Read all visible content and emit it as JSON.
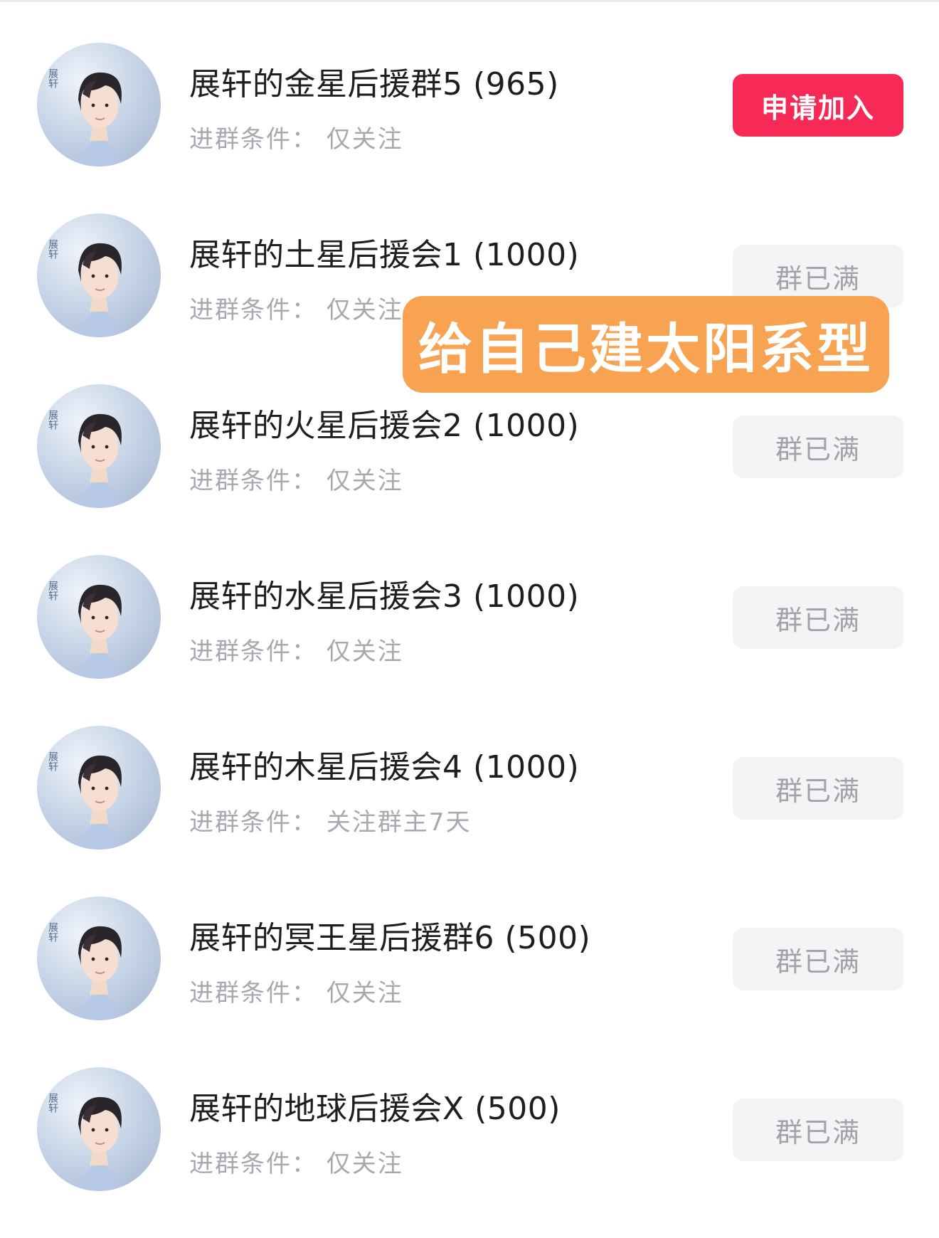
{
  "groups": [
    {
      "name": "展轩的金星后援群5 (965)",
      "condition": "进群条件： 仅关注",
      "button": "申请加入",
      "button_state": "join"
    },
    {
      "name": "展轩的土星后援会1 (1000)",
      "condition": "进群条件： 仅关注",
      "button": "群已满",
      "button_state": "full"
    },
    {
      "name": "展轩的火星后援会2 (1000)",
      "condition": "进群条件： 仅关注",
      "button": "群已满",
      "button_state": "full"
    },
    {
      "name": "展轩的水星后援会3 (1000)",
      "condition": "进群条件： 仅关注",
      "button": "群已满",
      "button_state": "full"
    },
    {
      "name": "展轩的木星后援会4 (1000)",
      "condition": "进群条件： 关注群主7天",
      "button": "群已满",
      "button_state": "full"
    },
    {
      "name": "展轩的冥王星后援群6 (500)",
      "condition": "进群条件： 仅关注",
      "button": "群已满",
      "button_state": "full"
    },
    {
      "name": "展轩的地球后援会X (500)",
      "condition": "进群条件： 仅关注",
      "button": "群已满",
      "button_state": "full"
    }
  ],
  "overlay": {
    "text": "给自己建太阳系型"
  },
  "avatar": {
    "watermark": "展轩"
  },
  "colors": {
    "join_button": "#f72a57",
    "full_button_bg": "#f4f4f6",
    "full_button_text": "#a1a3aa",
    "banner": "#f7a352"
  }
}
